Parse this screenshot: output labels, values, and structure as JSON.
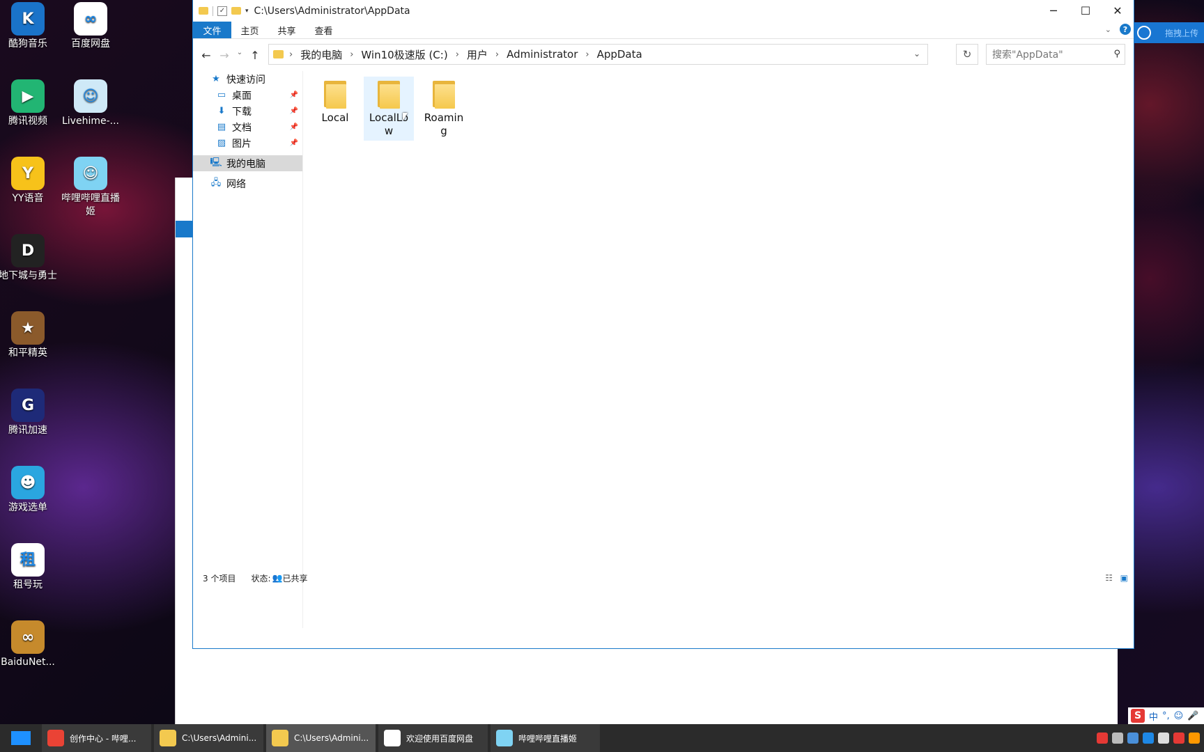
{
  "desktop": {
    "icons": [
      {
        "label": "酷狗音乐",
        "icon": "kugou-music-icon",
        "color": "#1a73c9",
        "glyph": "K"
      },
      {
        "label": "百度网盘",
        "icon": "baidu-netdisk-icon",
        "color": "#ffffff",
        "glyph": "∞"
      },
      {
        "label": "腾讯视频",
        "icon": "tencent-video-icon",
        "color": "#22b573",
        "glyph": "▶"
      },
      {
        "label": "Livehime-...",
        "icon": "livehime-icon",
        "color": "#cfe9f7",
        "glyph": "☺"
      },
      {
        "label": "YY语音",
        "icon": "yy-voice-icon",
        "color": "#f7c21a",
        "glyph": "Y"
      },
      {
        "label": "哔哩哔哩直播姬",
        "icon": "bilibili-live-icon",
        "color": "#7fd3f3",
        "glyph": "☺"
      },
      {
        "label": "地下城与勇士",
        "icon": "dnf-icon",
        "color": "#222222",
        "glyph": "D"
      },
      {
        "label": "和平精英",
        "icon": "peace-elite-icon",
        "color": "#8b5a2b",
        "glyph": "★"
      },
      {
        "label": "腾讯加速",
        "icon": "tencent-accelerator-icon",
        "color": "#1e2a78",
        "glyph": "G"
      },
      {
        "label": "游戏选单",
        "icon": "game-menu-icon",
        "color": "#2aa6e0",
        "glyph": "☻"
      },
      {
        "label": "租号玩",
        "icon": "zuhaowan-icon",
        "color": "#ffffff",
        "glyph": "租"
      },
      {
        "label": "BaiduNet...",
        "icon": "baidunet-icon",
        "color": "#c68a2c",
        "glyph": "∞"
      }
    ]
  },
  "window": {
    "title": "C:\\Users\\Administrator\\AppData",
    "controls": {
      "minimize": "─",
      "maximize": "☐",
      "close": "✕"
    },
    "ribbon": {
      "file": "文件",
      "tabs": [
        "主页",
        "共享",
        "查看"
      ],
      "help": "?"
    },
    "address": {
      "crumbs": [
        "我的电脑",
        "Win10极速版 (C:)",
        "用户",
        "Administrator",
        "AppData"
      ]
    },
    "search": {
      "placeholder": "搜索\"AppData\""
    },
    "nav_pane": {
      "quick_access": "快速访问",
      "items": [
        {
          "label": "桌面",
          "icon": "desktop-icon"
        },
        {
          "label": "下载",
          "icon": "download-icon"
        },
        {
          "label": "文档",
          "icon": "document-icon"
        },
        {
          "label": "图片",
          "icon": "picture-icon"
        }
      ],
      "this_pc": "我的电脑",
      "network": "网络"
    },
    "folders": [
      {
        "name": "Local"
      },
      {
        "name": "LocalLow",
        "display": "LocalLo\nw",
        "hover": true
      },
      {
        "name": "Roaming",
        "display": "Roamin\ng"
      }
    ],
    "status": {
      "count": "3 个项目",
      "state_label": "状态:",
      "state_value": "已共享"
    }
  },
  "upload_button": {
    "label": "拖拽上传"
  },
  "taskbar": {
    "items": [
      {
        "label": "创作中心 - 哔哩...",
        "icon": "chrome-icon",
        "color": "#ea4335"
      },
      {
        "label": "C:\\Users\\Admini...",
        "icon": "folder-icon",
        "color": "#f3c94f"
      },
      {
        "label": "C:\\Users\\Admini...",
        "icon": "folder-icon",
        "color": "#f3c94f",
        "active": true
      },
      {
        "label": "欢迎使用百度网盘",
        "icon": "baidu-netdisk-icon",
        "color": "#ffffff"
      },
      {
        "label": "哔哩哔哩直播姬",
        "icon": "bilibili-live-icon",
        "color": "#7fd3f3"
      }
    ]
  },
  "ime": {
    "logo": "S",
    "mode": "中",
    "punct": "°,"
  }
}
